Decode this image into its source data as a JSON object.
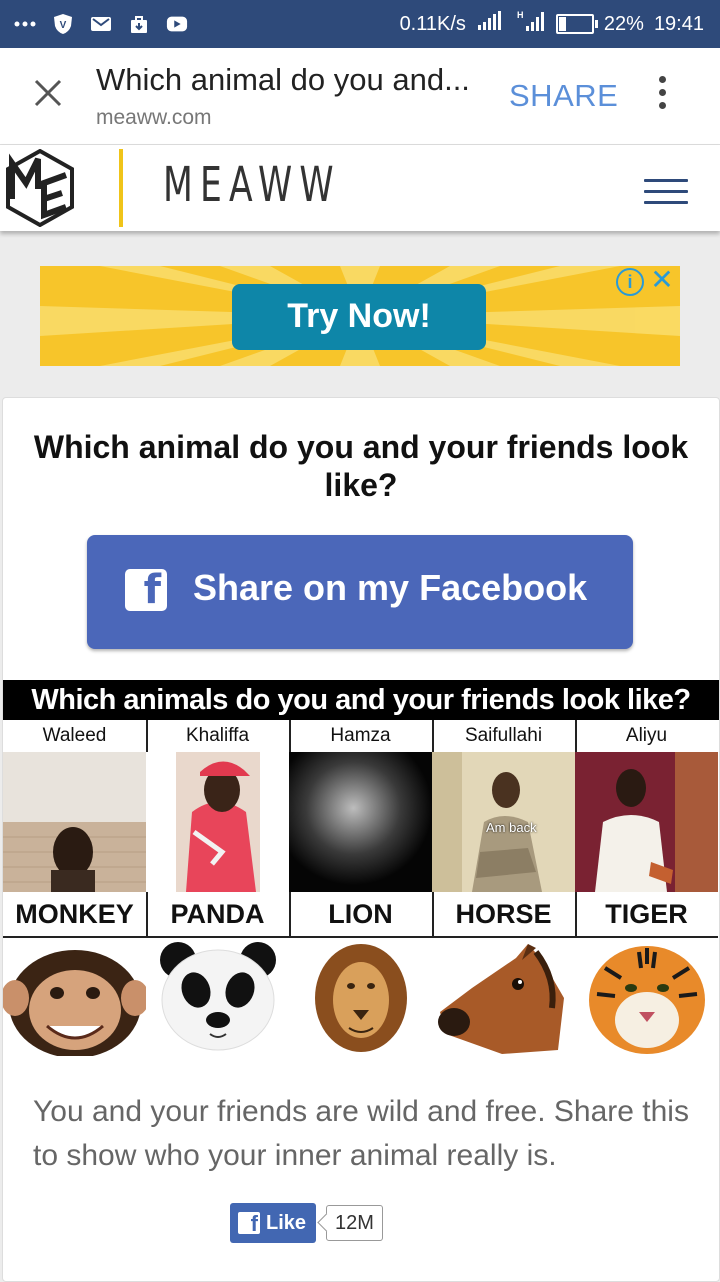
{
  "status_bar": {
    "network_speed": "0.11K/s",
    "signal_label": "H",
    "battery": "22%",
    "battery_level": 22,
    "time": "19:41",
    "left_icons": [
      "more-icon",
      "vpn-shield-icon",
      "gmail-icon",
      "download-bag-icon",
      "youtube-icon"
    ]
  },
  "browser": {
    "page_title": "Which animal do you and...",
    "url": "meaww.com",
    "share_label": "SHARE"
  },
  "site_header": {
    "logo_text": "ME",
    "brand": "MEAWW",
    "accent_color": "#f0c419"
  },
  "ad": {
    "cta": "Try Now!",
    "info_icon": "i",
    "close_icon": "✕"
  },
  "quiz": {
    "title": "Which animal do you and your friends look like?",
    "share_button": "Share on my Facebook",
    "result_heading": "Which animals do you and your friends look like?",
    "friends": [
      {
        "name": "Waleed",
        "animal": "MONKEY"
      },
      {
        "name": "Khaliffa",
        "animal": "PANDA"
      },
      {
        "name": "Hamza",
        "animal": "LION"
      },
      {
        "name": "Saifullahi",
        "animal": "HORSE",
        "photo_caption": "Am back"
      },
      {
        "name": "Aliyu",
        "animal": "TIGER"
      }
    ],
    "description": "You and your friends are wild and free. Share this to show who your inner animal really is."
  },
  "fb_like": {
    "label": "Like",
    "count": "12M"
  }
}
